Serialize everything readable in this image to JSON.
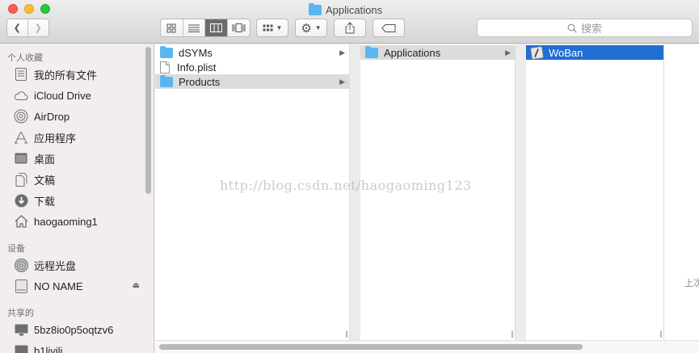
{
  "window": {
    "title": "Applications"
  },
  "toolbar": {
    "back_glyph": "❮",
    "forward_glyph": "❯",
    "search_placeholder": "搜索"
  },
  "sidebar": {
    "favorites_header": "个人收藏",
    "favorites": [
      {
        "label": "我的所有文件",
        "icon": "all-files-icon"
      },
      {
        "label": "iCloud Drive",
        "icon": "cloud-icon"
      },
      {
        "label": "AirDrop",
        "icon": "airdrop-icon"
      },
      {
        "label": "应用程序",
        "icon": "applications-icon"
      },
      {
        "label": "桌面",
        "icon": "desktop-icon"
      },
      {
        "label": "文稿",
        "icon": "documents-icon"
      },
      {
        "label": "下载",
        "icon": "download-icon"
      },
      {
        "label": "haogaoming1",
        "icon": "home-icon"
      }
    ],
    "devices_header": "设备",
    "devices": [
      {
        "label": "远程光盘",
        "icon": "disc-icon"
      },
      {
        "label": "NO NAME",
        "icon": "drive-icon"
      }
    ],
    "shared_header": "共享的",
    "shared": [
      {
        "label": "5bz8io0p5oqtzv6",
        "icon": "computer-icon"
      },
      {
        "label": "b1liyili",
        "icon": "computer-icon"
      }
    ]
  },
  "columns": {
    "col1": [
      {
        "name": "dSYMs",
        "type": "folder"
      },
      {
        "name": "Info.plist",
        "type": "file"
      },
      {
        "name": "Products",
        "type": "folder"
      }
    ],
    "col2": [
      {
        "name": "Applications",
        "type": "folder"
      }
    ],
    "col3": [
      {
        "name": "WoBan",
        "type": "app"
      }
    ]
  },
  "preview": {
    "partial_text": "上次"
  },
  "watermark": {
    "text": "http://blog.csdn.net/haogaoming123"
  },
  "colors": {
    "selection_blue": "#1f6ed4",
    "folder_blue": "#5ab6ef"
  }
}
